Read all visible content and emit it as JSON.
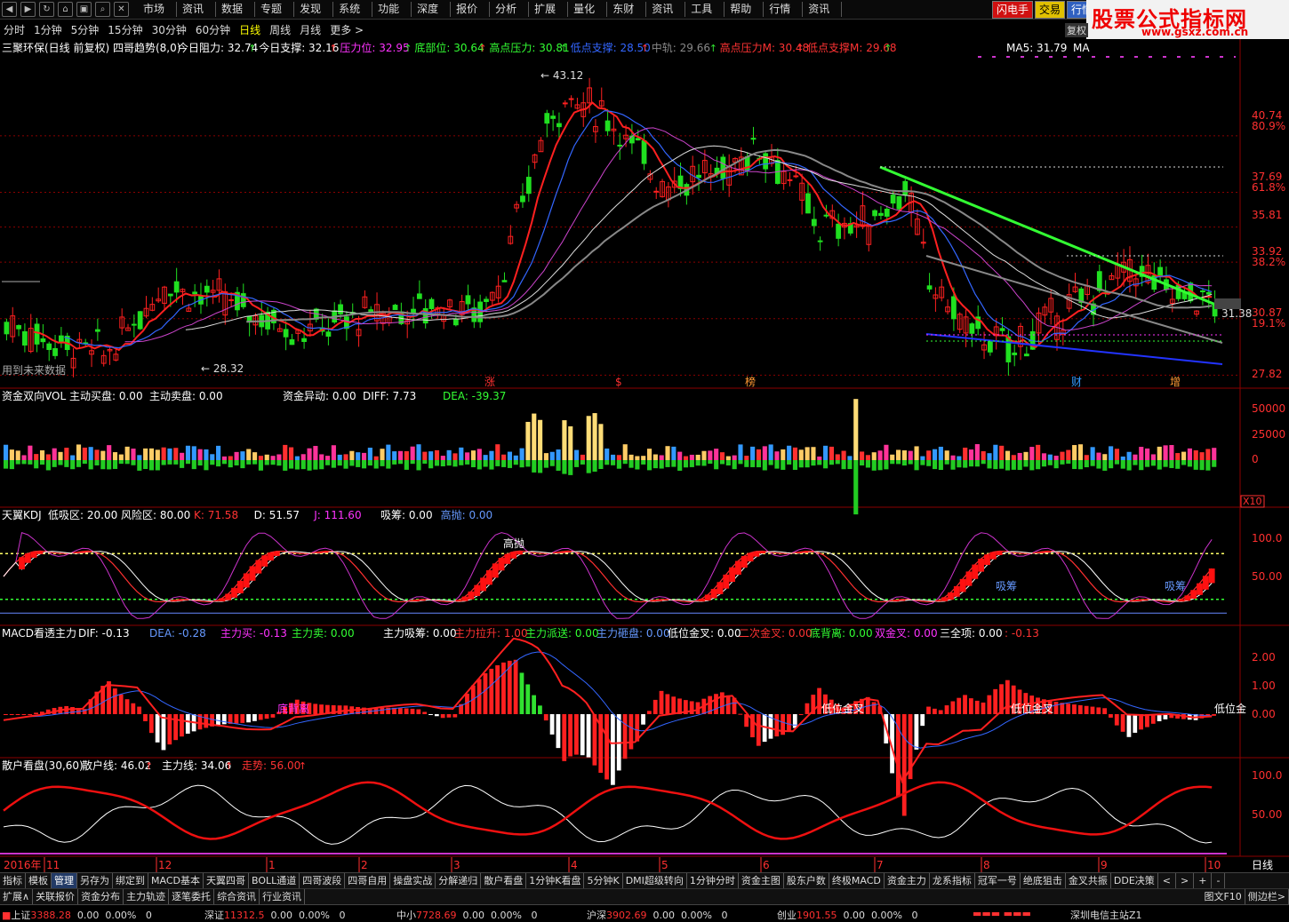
{
  "menu": {
    "items": [
      "市场",
      "资讯",
      "数据",
      "专题",
      "发现",
      "系统",
      "功能",
      "深度",
      "报价",
      "分析",
      "扩展",
      "量化",
      "东财",
      "资讯",
      "工具",
      "帮助",
      "行情",
      "资讯"
    ],
    "flash_tabs": [
      {
        "label": "闪电手",
        "bg": "#d01010",
        "fg": "#ffffff"
      },
      {
        "label": "交易",
        "bg": "#e0c000",
        "fg": "#000000"
      },
      {
        "label": "行情",
        "bg": "#3060c0",
        "fg": "#ffffff"
      }
    ]
  },
  "brand": {
    "title": "股票公式指标网",
    "url": "www.gsxz.com.cn"
  },
  "periods": [
    "分时",
    "1分钟",
    "5分钟",
    "15分钟",
    "30分钟",
    "60分钟",
    "日线",
    "周线",
    "月线",
    "更多 >"
  ],
  "active_period": "日线",
  "fq_button": "复权",
  "chart_data": [
    {
      "type": "candlestick",
      "title": "三聚环保(日线 前复权) 四哥趋势(8,0)",
      "legend": [
        {
          "text": "今日阻力: 32.74",
          "color": "#ffffff"
        },
        {
          "text": "今日支撑: 32.16",
          "color": "#ffffff"
        },
        {
          "text": "压力位: 32.95",
          "color": "#ff33ff"
        },
        {
          "text": "底部位: 30.64",
          "color": "#33ff33"
        },
        {
          "text": "高点压力: 30.81",
          "color": "#33ff33"
        },
        {
          "text": "低点支撑: 28.50",
          "color": "#3366ff"
        },
        {
          "text": "中轨: 29.66",
          "color": "#888888"
        },
        {
          "text": "高点压力M: 30.48",
          "color": "#ff3333"
        },
        {
          "text": "低点支撑M: 29.68",
          "color": "#ff3333"
        }
      ],
      "ma_label": "MA5: 31.79",
      "ma_label2": "MA",
      "price_ticks": [
        "40.74",
        "37.69",
        "35.81",
        "33.92",
        "30.87",
        "27.82"
      ],
      "pct_ticks": [
        "80.9%",
        "61.8%",
        "38.2%",
        "19.1%"
      ],
      "ylim": [
        27.5,
        45
      ],
      "high_mark": "43.12",
      "low_mark": "28.32",
      "last_mark": "31.38",
      "note": "用到未来数据",
      "event_markers": [
        "涨",
        "$",
        "榜",
        "财",
        "增"
      ]
    },
    {
      "type": "bar",
      "title": "资金双向VOL",
      "legend": [
        {
          "text": "主动买盘: 0.00",
          "color": "#ffffff"
        },
        {
          "text": "主动卖盘: 0.00",
          "color": "#ffffff"
        },
        {
          "text": "资金异动: 0.00",
          "color": "#ffffff"
        },
        {
          "text": "DIFF: 7.73",
          "color": "#ffffff"
        },
        {
          "text": "DEA: -39.37",
          "color": "#33ff33"
        }
      ],
      "ticks": [
        "50000",
        "25000",
        "0"
      ],
      "scale": "X10"
    },
    {
      "type": "line",
      "title": "天翼KDJ",
      "legend": [
        {
          "text": "低吸区: 20.00",
          "color": "#ffffff"
        },
        {
          "text": "风险区: 80.00",
          "color": "#ffffff"
        },
        {
          "text": "K: 71.58",
          "color": "#ff3333"
        },
        {
          "text": "D: 51.57",
          "color": "#ffffff"
        },
        {
          "text": "J: 111.60",
          "color": "#ff33ff"
        },
        {
          "text": "吸筹: 0.00",
          "color": "#ffffff"
        },
        {
          "text": "高抛: 0.00",
          "color": "#6699ff"
        }
      ],
      "ticks": [
        "100.0",
        "50.00"
      ],
      "annotations": [
        "高抛",
        "吸筹",
        "吸筹"
      ]
    },
    {
      "type": "bar",
      "title": "MACD看透主力",
      "legend": [
        {
          "text": "DIF: -0.13",
          "color": "#ffffff"
        },
        {
          "text": "DEA: -0.28",
          "color": "#6699ff"
        },
        {
          "text": "主力买: -0.13",
          "color": "#ff33ff"
        },
        {
          "text": "主力卖: 0.00",
          "color": "#33ff33"
        },
        {
          "text": "主力吸筹: 0.00",
          "color": "#ffffff"
        },
        {
          "text": "主力拉升: 1.00",
          "color": "#ff3333"
        },
        {
          "text": "主力派送: 0.00",
          "color": "#33ff33"
        },
        {
          "text": "主力砸盘: 0.00",
          "color": "#6699ff"
        },
        {
          "text": "低位金叉: 0.00",
          "color": "#ffffff"
        },
        {
          "text": "二次金叉: 0.00",
          "color": "#ff3333"
        },
        {
          "text": "底背离: 0.00",
          "color": "#33ff33"
        },
        {
          "text": "双金叉: 0.00",
          "color": "#ff33ff"
        },
        {
          "text": "三全项: 0.00",
          "color": "#ffffff"
        },
        {
          "text": ": -0.13",
          "color": "#ff3333"
        }
      ],
      "ticks": [
        "2.00",
        "1.00",
        "0.00"
      ],
      "annotations": [
        "底背离",
        "低位金叉",
        "低位金叉",
        "低位金"
      ]
    },
    {
      "type": "line",
      "title": "散户看盘(30,60)",
      "legend": [
        {
          "text": "散户线: 46.02",
          "color": "#ffffff"
        },
        {
          "text": "主力线: 34.06",
          "color": "#ffffff"
        },
        {
          "text": "走势: 56.00",
          "color": "#ff3333"
        }
      ],
      "ticks": [
        "100.0",
        "50.00"
      ]
    }
  ],
  "timeline": {
    "year": "2016年",
    "months": [
      "11",
      "12",
      "1",
      "2",
      "3",
      "4",
      "5",
      "6",
      "7",
      "8",
      "9",
      "10"
    ],
    "period_btn": "日线"
  },
  "tabs_row1": [
    "指标",
    "模板",
    "管理",
    "另存为",
    "绑定到",
    "MACD基本",
    "天翼四哥",
    "BOLL通道",
    "四哥波段",
    "四哥自用",
    "操盘实战",
    "分解递归",
    "散户看盘",
    "1分钟K看盘",
    "5分钟K",
    "DMI超级转向",
    "1分钟分时",
    "资金主图",
    "股东户数",
    "终极MACD",
    "资金主力",
    "龙系指标",
    "冠军一号",
    "绝底狙击",
    "金叉共振",
    "DDE决策"
  ],
  "tabs_row1_active": "管理",
  "tabs_row1_nav": [
    "<",
    ">",
    "+",
    "-"
  ],
  "tabs_row2": [
    "扩展∧",
    "关联报价",
    "资金分布",
    "主力轨迹",
    "逐笔委托",
    "综合资讯",
    "行业资讯"
  ],
  "tabs_row2_right": [
    "图文F10",
    "侧边栏>"
  ],
  "status": {
    "sh": {
      "name": "上证",
      "val": "3388.28",
      "chg": "0.00",
      "pct": "0.00%",
      "vol": "0"
    },
    "sz": {
      "name": "深证",
      "val": "11312.5",
      "chg": "0.00",
      "pct": "0.00%",
      "vol": "0"
    },
    "zx": {
      "name": "中小",
      "val": "7728.69",
      "chg": "0.00",
      "pct": "0.00%",
      "vol": "0"
    },
    "hs": {
      "name": "沪深",
      "val": "3902.69",
      "chg": "0.00",
      "pct": "0.00%",
      "vol": "0"
    },
    "cy": {
      "name": "创业",
      "val": "1901.55",
      "chg": "0.00",
      "pct": "0.00%",
      "vol": "0"
    },
    "server": "深圳电信主站Z1"
  }
}
